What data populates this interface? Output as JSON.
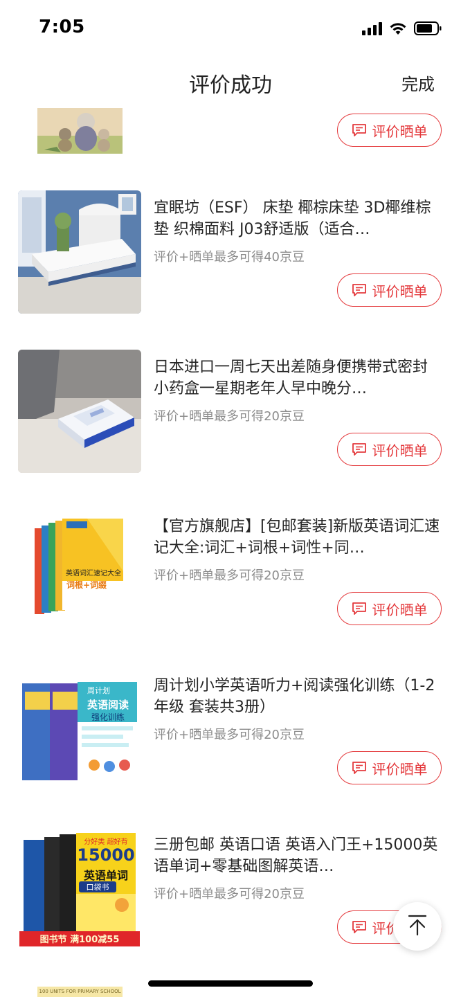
{
  "status_bar": {
    "time": "7:05"
  },
  "header": {
    "title": "评价成功",
    "done_label": "完成"
  },
  "review_button_label": "评价晒单",
  "items": [
    {
      "title": "",
      "hint": ""
    },
    {
      "title": "宜眠坊（ESF） 床垫 椰棕床垫 3D椰维棕垫 织棉面料 J03舒适版（适合…",
      "hint": "评价+晒单最多可得40京豆"
    },
    {
      "title": "日本进口一周七天出差随身便携带式密封小药盒一星期老年人早中晚分…",
      "hint": "评价+晒单最多可得20京豆"
    },
    {
      "title": "【官方旗舰店】[包邮套装]新版英语词汇速记大全:词汇+词根+词性+同…",
      "hint": "评价+晒单最多可得20京豆"
    },
    {
      "title": "周计划小学英语听力+阅读强化训练（1-2年级 套装共3册）",
      "hint": "评价+晒单最多可得20京豆"
    },
    {
      "title": "三册包邮 英语口语 英语入门王+15000英语单词+零基础图解英语…",
      "hint": "评价+晒单最多可得20京豆"
    }
  ],
  "images": {
    "book_cover_1": {
      "line1": "英语词汇速记大全",
      "line2": "词根+词缀"
    },
    "book_cover_2": {
      "brand": "周计划",
      "line1": "英语阅读",
      "line2": "强化训练"
    },
    "book_cover_3": {
      "top": "分好类 超好背",
      "number": "15000",
      "line1": "英语单词",
      "line2": "口袋书"
    },
    "promo_banner": "图书节 满100减55",
    "peek_text": "100 UNITS FOR PRIMARY SCHOOL"
  },
  "colors": {
    "accent": "#e4393c",
    "hint_gray": "#8c8c8c"
  }
}
